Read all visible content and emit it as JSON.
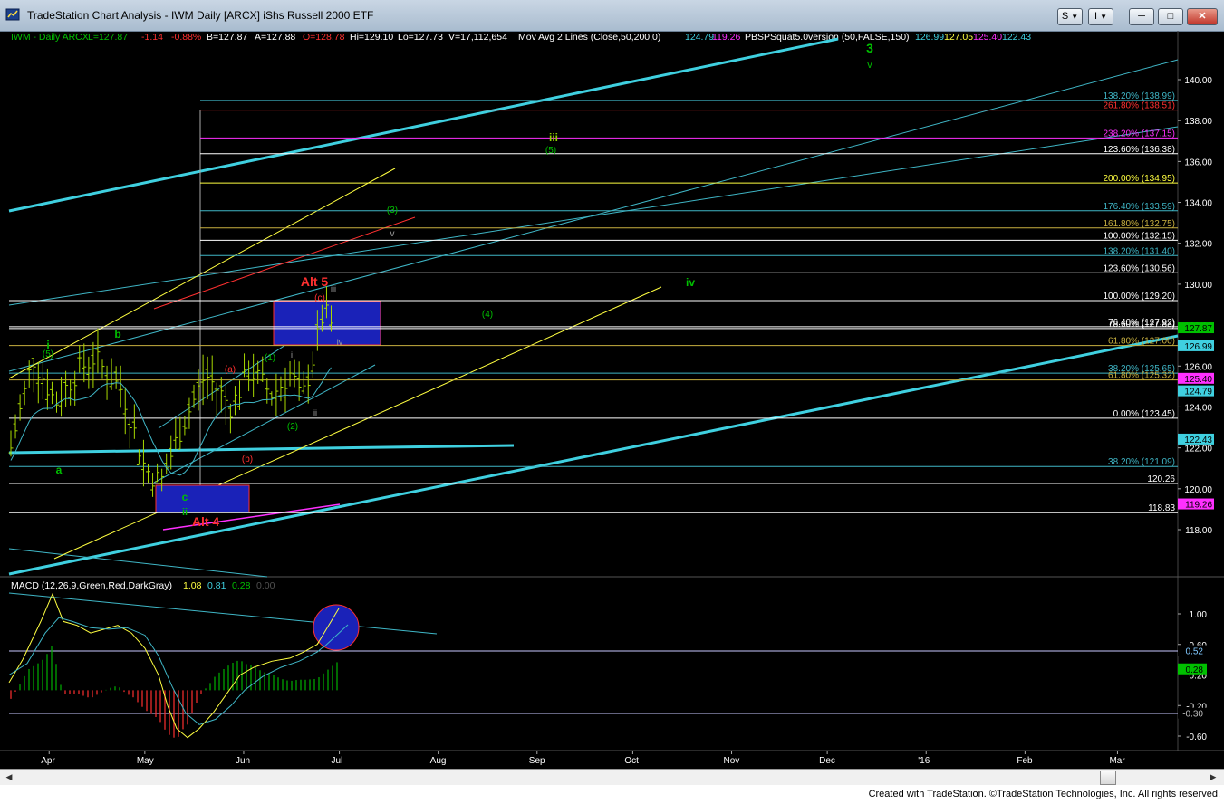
{
  "window": {
    "title": "TradeStation Chart Analysis - IWM Daily [ARCX] iShs Russell 2000 ETF",
    "toolbar": [
      "S",
      "I"
    ],
    "controls": {
      "minimize": "─",
      "maximize": "□",
      "close": "✕"
    },
    "icons": {
      "app": "chart-app-icon",
      "dropdown": "chevron-down-icon"
    }
  },
  "header": {
    "symbol": "IWM - Daily  ARCX",
    "last": "L=127.87",
    "change": "-1.14",
    "change_pct": "-0.88%",
    "bid": "B=127.87",
    "ask": "A=127.88",
    "open": "O=128.78",
    "high": "Hi=129.10",
    "low": "Lo=127.73",
    "volume": "V=17,112,654",
    "ma_label": "Mov Avg 2 Lines (Close,50,200,0)",
    "ma_values": [
      "124.79",
      "119.26"
    ],
    "pbs_label": "PBSPSquat5.0version (50,FALSE,150)",
    "pbs_values": [
      "126.99",
      "127.05",
      "125.40",
      "122.43"
    ],
    "colors": {
      "green": "#00c000",
      "red": "#ff3030",
      "cyan": "#3fd0e0",
      "magenta": "#ff30ff",
      "yellow": "#ffff40",
      "white": "#ffffff"
    }
  },
  "fib_levels": [
    {
      "label": "138.20% (138.99)",
      "color": "#3fb6c6"
    },
    {
      "label": "261.80% (138.51)",
      "color": "#ff3030"
    },
    {
      "label": "238.20% (137.15)",
      "color": "#ff30ff"
    },
    {
      "label": "123.60% (136.38)",
      "color": "#ffffff"
    },
    {
      "label": "200.00% (134.95)",
      "color": "#ffff40"
    },
    {
      "label": "176.40% (133.59)",
      "color": "#3fb6c6"
    },
    {
      "label": "161.80% (132.75)",
      "color": "#c8b040"
    },
    {
      "label": "100.00% (132.15)",
      "color": "#ffffff"
    },
    {
      "label": "138.20% (131.40)",
      "color": "#3fb6c6"
    },
    {
      "label": "123.60% (130.56)",
      "color": "#ffffff"
    },
    {
      "label": "100.00% (129.20)",
      "color": "#ffffff"
    },
    {
      "label": "76.40% (127.92)",
      "color": "#ffffff"
    },
    {
      "label": "78.60% (127.83)",
      "color": "#ffffff"
    },
    {
      "label": "61.80% (127.00)",
      "color": "#c8b040"
    },
    {
      "label": "38.20% (125.65)",
      "color": "#3fb6c6"
    },
    {
      "label": "61.80% (125.32)",
      "color": "#c8b040"
    },
    {
      "label": "0.00% (123.45)",
      "color": "#ffffff"
    },
    {
      "label": "38.20% (121.09)",
      "color": "#3fb6c6"
    },
    {
      "label": "120.26",
      "color": "#ffffff"
    },
    {
      "label": "118.83",
      "color": "#ffffff"
    }
  ],
  "wave_labels": [
    {
      "text": "3",
      "color": "#00c000"
    },
    {
      "text": "v",
      "color": "#00c000"
    },
    {
      "text": "iii",
      "color": "#90d000"
    },
    {
      "text": "(5)",
      "color": "#00c000"
    },
    {
      "text": "(3)",
      "color": "#00c000"
    },
    {
      "text": "v",
      "color": "#a0a0a0"
    },
    {
      "text": "iv",
      "color": "#00c000"
    },
    {
      "text": "(4)",
      "color": "#00c000"
    },
    {
      "text": "Alt 5",
      "color": "#ff3030"
    },
    {
      "text": "(c)",
      "color": "#ff3030"
    },
    {
      "text": "iii",
      "color": "#a0a0a0"
    },
    {
      "text": "iv",
      "color": "#a0a0a0"
    },
    {
      "text": "(1)",
      "color": "#00c000"
    },
    {
      "text": "i",
      "color": "#a0a0a0"
    },
    {
      "text": "(a)",
      "color": "#ff3030"
    },
    {
      "text": "ii",
      "color": "#a0a0a0"
    },
    {
      "text": "(2)",
      "color": "#00c000"
    },
    {
      "text": "(b)",
      "color": "#ff3030"
    },
    {
      "text": "i",
      "color": "#00c000"
    },
    {
      "text": "(5)",
      "color": "#00c000"
    },
    {
      "text": "b",
      "color": "#00c000"
    },
    {
      "text": "a",
      "color": "#00c000"
    },
    {
      "text": "c",
      "color": "#00c000"
    },
    {
      "text": "ii",
      "color": "#00c000"
    },
    {
      "text": "Alt 4",
      "color": "#ff3030"
    }
  ],
  "macd": {
    "label": "MACD (12,26,9,Green,Red,DarkGray)",
    "values": [
      "1.08",
      "0.81",
      "0.28",
      "0.00"
    ],
    "value_colors": [
      "#ffff40",
      "#3fd0e0",
      "#00c000",
      "#505050"
    ],
    "axis_ticks": [
      "1.00",
      "0.60",
      "0.20",
      "-0.20",
      "-0.60"
    ],
    "markers": [
      {
        "text": "0.52",
        "bg": "#000000",
        "fg": "#80c8ff"
      },
      {
        "text": "0.28",
        "bg": "#00c000",
        "fg": "#000000"
      },
      {
        "text": "-0.30",
        "bg": "#000000",
        "fg": "#c0c0c0"
      }
    ]
  },
  "price_markers": [
    {
      "text": "127.87",
      "bg": "#00c000",
      "fg": "#000000"
    },
    {
      "text": "126.99",
      "bg": "#3fd0e0",
      "fg": "#000000"
    },
    {
      "text": "125.40",
      "bg": "#ff30ff",
      "fg": "#000000"
    },
    {
      "text": "124.79",
      "bg": "#3fd0e0",
      "fg": "#000000"
    },
    {
      "text": "122.43",
      "bg": "#3fd0e0",
      "fg": "#000000"
    },
    {
      "text": "119.26",
      "bg": "#ff30ff",
      "fg": "#000000"
    }
  ],
  "chart_data": {
    "type": "line",
    "title": "IWM - Daily ARCX",
    "x_ticks": [
      "Apr",
      "May",
      "Jun",
      "Jul",
      "Aug",
      "Sep",
      "Oct",
      "Nov",
      "Dec",
      "'16",
      "Feb",
      "Mar"
    ],
    "y_ticks": [
      "140.00",
      "138.00",
      "136.00",
      "134.00",
      "132.00",
      "130.00",
      "128.00",
      "126.00",
      "124.00",
      "122.00",
      "120.00",
      "118.00"
    ],
    "ylim": [
      116,
      142
    ],
    "price_path_approx": [
      {
        "x": "2015-03-20",
        "close": 122.0
      },
      {
        "x": "2015-03-27",
        "close": 126.4
      },
      {
        "x": "2015-04-03",
        "close": 124.2
      },
      {
        "x": "2015-04-10",
        "close": 125.8
      },
      {
        "x": "2015-04-15",
        "close": 126.4
      },
      {
        "x": "2015-04-24",
        "close": 124.8
      },
      {
        "x": "2015-05-01",
        "close": 121.0
      },
      {
        "x": "2015-05-06",
        "close": 120.3
      },
      {
        "x": "2015-05-12",
        "close": 122.8
      },
      {
        "x": "2015-05-20",
        "close": 125.6
      },
      {
        "x": "2015-05-28",
        "close": 124.0
      },
      {
        "x": "2015-06-03",
        "close": 125.8
      },
      {
        "x": "2015-06-10",
        "close": 124.6
      },
      {
        "x": "2015-06-16",
        "close": 125.7
      },
      {
        "x": "2015-06-19",
        "close": 124.2
      },
      {
        "x": "2015-06-23",
        "close": 126.5
      },
      {
        "x": "2015-06-26",
        "close": 128.7
      },
      {
        "x": "2015-06-29",
        "close": 127.87
      }
    ],
    "series": [
      {
        "name": "Mov Avg 50",
        "last": 124.79
      },
      {
        "name": "Mov Avg 200",
        "last": 119.26
      }
    ]
  },
  "footer": "Created with TradeStation. ©TradeStation Technologies, Inc. All rights reserved."
}
